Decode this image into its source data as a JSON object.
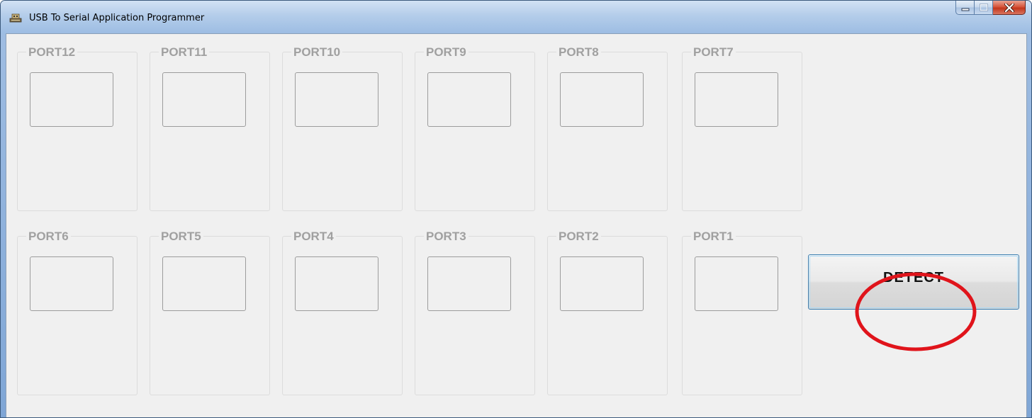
{
  "window": {
    "title": "USB To Serial Application Programmer",
    "app_icon": "usb-serial-app-icon",
    "caption_buttons": [
      "minimize-icon",
      "maximize-icon",
      "close-icon"
    ]
  },
  "ports": {
    "row1": [
      "PORT12",
      "PORT11",
      "PORT10",
      "PORT9",
      "PORT8",
      "PORT7"
    ],
    "row2": [
      "PORT6",
      "PORT5",
      "PORT4",
      "PORT3",
      "PORT2",
      "PORT1"
    ]
  },
  "detect_button": {
    "label": "DETECT"
  },
  "annotation": {
    "shape": "ellipse",
    "color": "#e0141b",
    "target": "detect-button"
  }
}
